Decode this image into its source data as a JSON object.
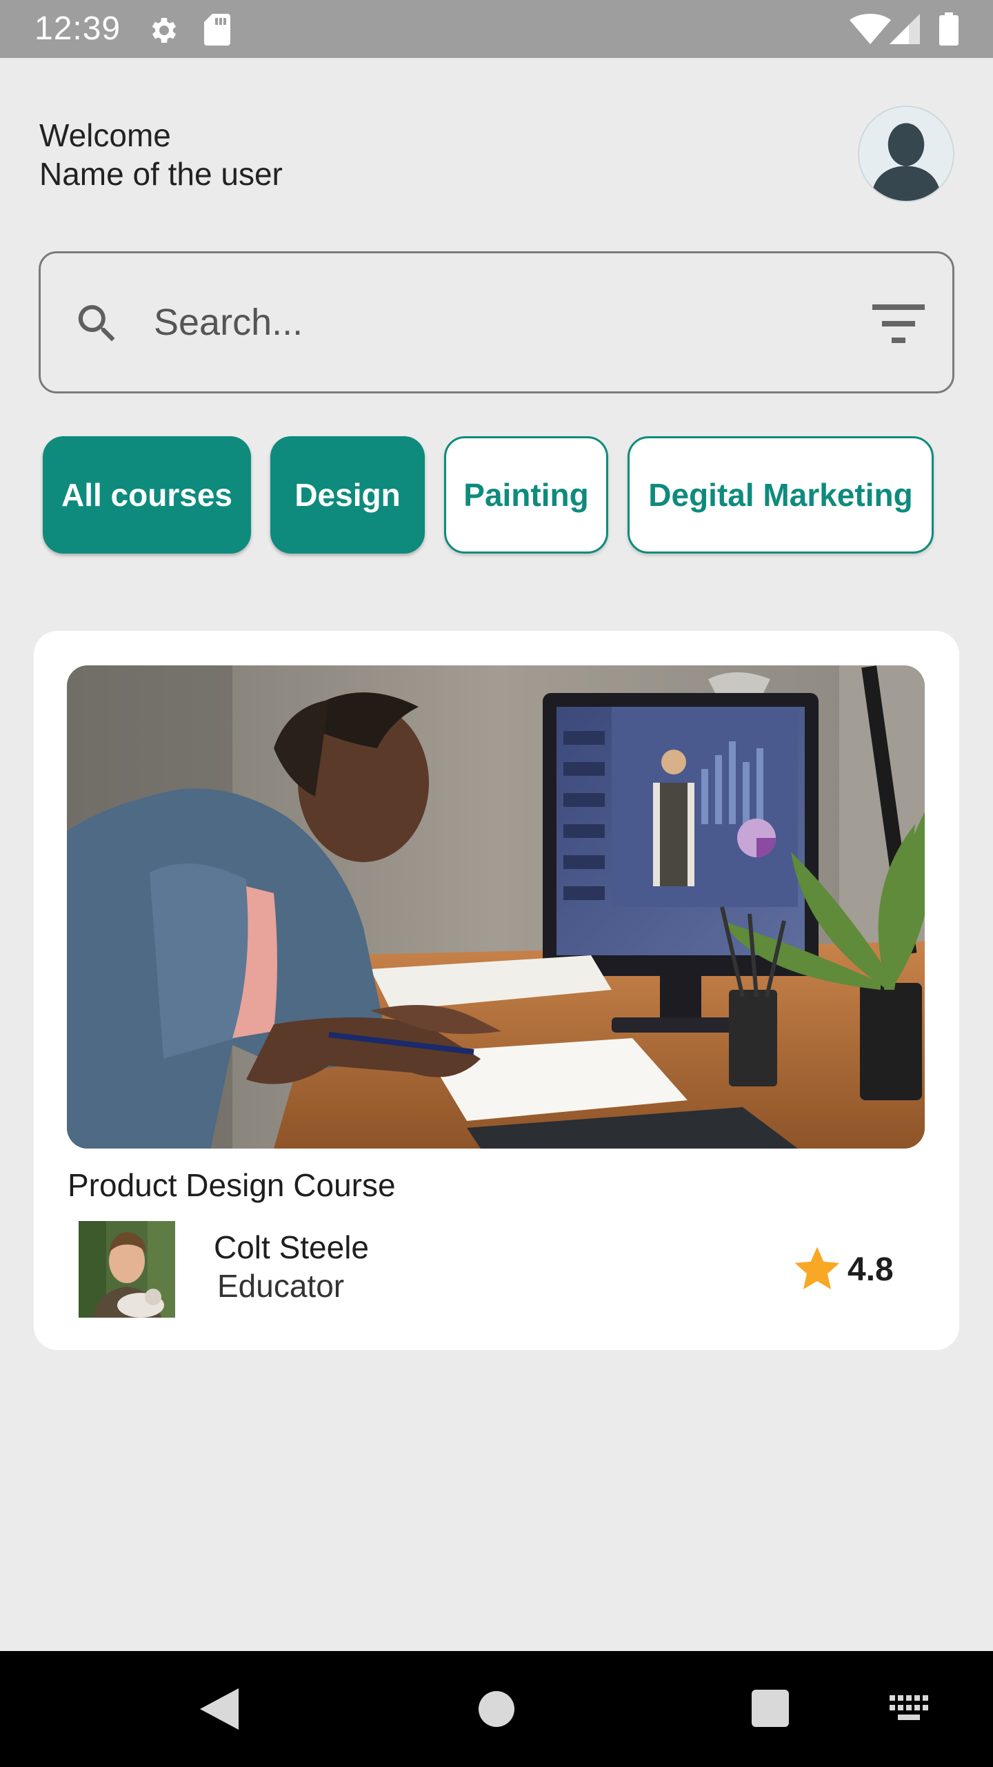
{
  "status_bar": {
    "time": "12:39",
    "icons": [
      "gear-icon",
      "sd-card-icon",
      "wifi-icon",
      "cell-signal-icon",
      "battery-icon"
    ]
  },
  "header": {
    "greeting": "Welcome",
    "user_name": "Name of the user",
    "avatar_icon": "person-silhouette-icon"
  },
  "search": {
    "placeholder": "Search...",
    "value": "",
    "icon": "search-icon",
    "filter_icon": "filter-icon"
  },
  "categories": [
    {
      "label": "All courses",
      "selected": true
    },
    {
      "label": "Design",
      "selected": true
    },
    {
      "label": "Painting",
      "selected": false
    },
    {
      "label": "Degital Marketing",
      "selected": false
    }
  ],
  "course_card": {
    "title": "Product Design Course",
    "educator_name": "Colt Steele",
    "educator_role": "Educator",
    "rating": "4.8"
  },
  "nav_bar": {
    "icons": [
      "back-icon",
      "home-icon",
      "recents-icon",
      "keyboard-icon"
    ]
  },
  "colors": {
    "accent": "#0e8b7d",
    "background": "#ebebeb",
    "star": "#f9a825"
  }
}
